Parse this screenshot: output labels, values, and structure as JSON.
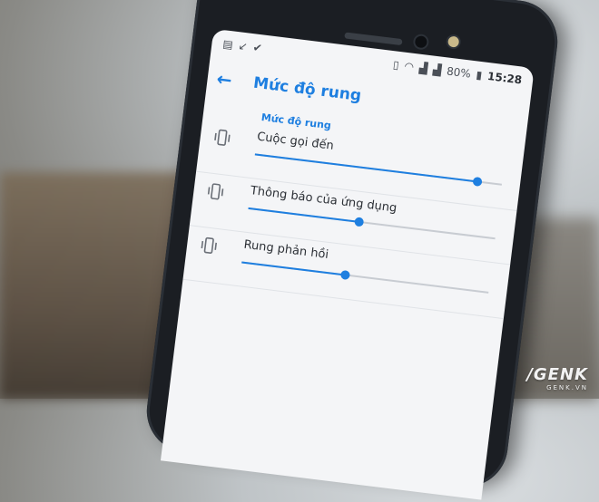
{
  "status_bar": {
    "left_icons": [
      "notification-icon",
      "missed-call-icon",
      "check-icon"
    ],
    "battery": "80%",
    "time": "15:28"
  },
  "app_bar": {
    "back_icon": "arrow-left-icon",
    "title": "Mức độ rung"
  },
  "section_title": "Mức độ rung",
  "sliders": [
    {
      "label": "Cuộc gọi đến",
      "value": 0.9
    },
    {
      "label": "Thông báo của ứng dụng",
      "value": 0.45
    },
    {
      "label": "Rung phản hồi",
      "value": 0.42
    }
  ],
  "watermark": {
    "logo": "GENK",
    "site": "GENK.VN"
  },
  "colors": {
    "accent": "#1e7fe0",
    "screen_bg": "#f4f5f7",
    "phone_body": "#1b1e23"
  }
}
